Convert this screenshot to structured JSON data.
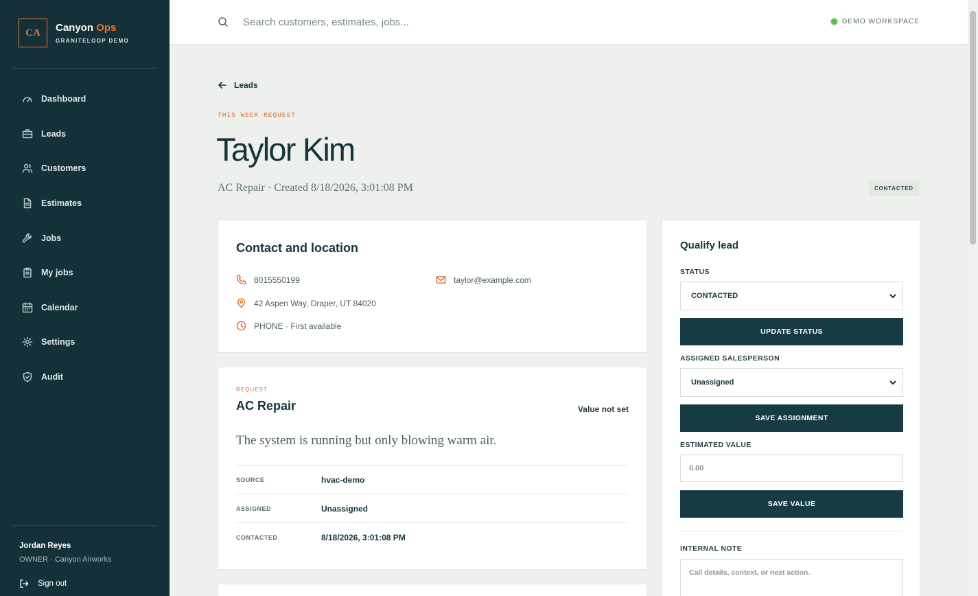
{
  "brand": {
    "logo": "CA",
    "name_primary": "Canyon",
    "name_accent": "Ops",
    "subtitle": "GRANITELOOP DEMO"
  },
  "nav": [
    {
      "label": "Dashboard",
      "icon": "gauge-icon"
    },
    {
      "label": "Leads",
      "icon": "briefcase-icon"
    },
    {
      "label": "Customers",
      "icon": "users-icon"
    },
    {
      "label": "Estimates",
      "icon": "document-icon"
    },
    {
      "label": "Jobs",
      "icon": "wrench-icon"
    },
    {
      "label": "My jobs",
      "icon": "clipboard-icon"
    },
    {
      "label": "Calendar",
      "icon": "calendar-icon"
    },
    {
      "label": "Settings",
      "icon": "gear-icon"
    },
    {
      "label": "Audit",
      "icon": "shield-icon"
    }
  ],
  "user": {
    "name": "Jordan Reyes",
    "role": "OWNER · Canyon Airworks",
    "signout_label": "Sign out"
  },
  "search": {
    "placeholder": "Search customers, estimates, jobs..."
  },
  "workspace": {
    "label": "DEMO WORKSPACE",
    "status_color": "#5cb84a"
  },
  "page": {
    "back_label": "Leads",
    "eyebrow": "THIS WEEK REQUEST",
    "title": "Taylor Kim",
    "subtitle": "AC Repair · Created 8/18/2026, 3:01:08 PM",
    "status_badge": "CONTACTED"
  },
  "contact": {
    "title": "Contact and location",
    "phone": "8015550199",
    "email": "taylor@example.com",
    "address": "42 Aspen Way, Draper, UT 84020",
    "preference": "PHONE · First available"
  },
  "request": {
    "eyebrow": "REQUEST",
    "title": "AC Repair",
    "value_label": "Value not set",
    "description": "The system is running but only blowing warm air.",
    "details": [
      {
        "key": "SOURCE",
        "value": "hvac-demo"
      },
      {
        "key": "ASSIGNED",
        "value": "Unassigned"
      },
      {
        "key": "CONTACTED",
        "value": "8/18/2026, 3:01:08 PM"
      }
    ]
  },
  "qualify": {
    "title": "Qualify lead",
    "status_label": "STATUS",
    "status_value": "CONTACTED",
    "update_status_button": "UPDATE STATUS",
    "salesperson_label": "ASSIGNED SALESPERSON",
    "salesperson_value": "Unassigned",
    "save_assignment_button": "SAVE ASSIGNMENT",
    "value_label": "ESTIMATED VALUE",
    "value_placeholder": "0.00",
    "save_value_button": "SAVE VALUE",
    "note_label": "INTERNAL NOTE",
    "note_placeholder": "Call details, context, or next action."
  },
  "colors": {
    "sidebar_bg": "#14313a",
    "accent": "#e8762f",
    "button_dark": "#173b42",
    "page_bg": "#eef0ed"
  }
}
